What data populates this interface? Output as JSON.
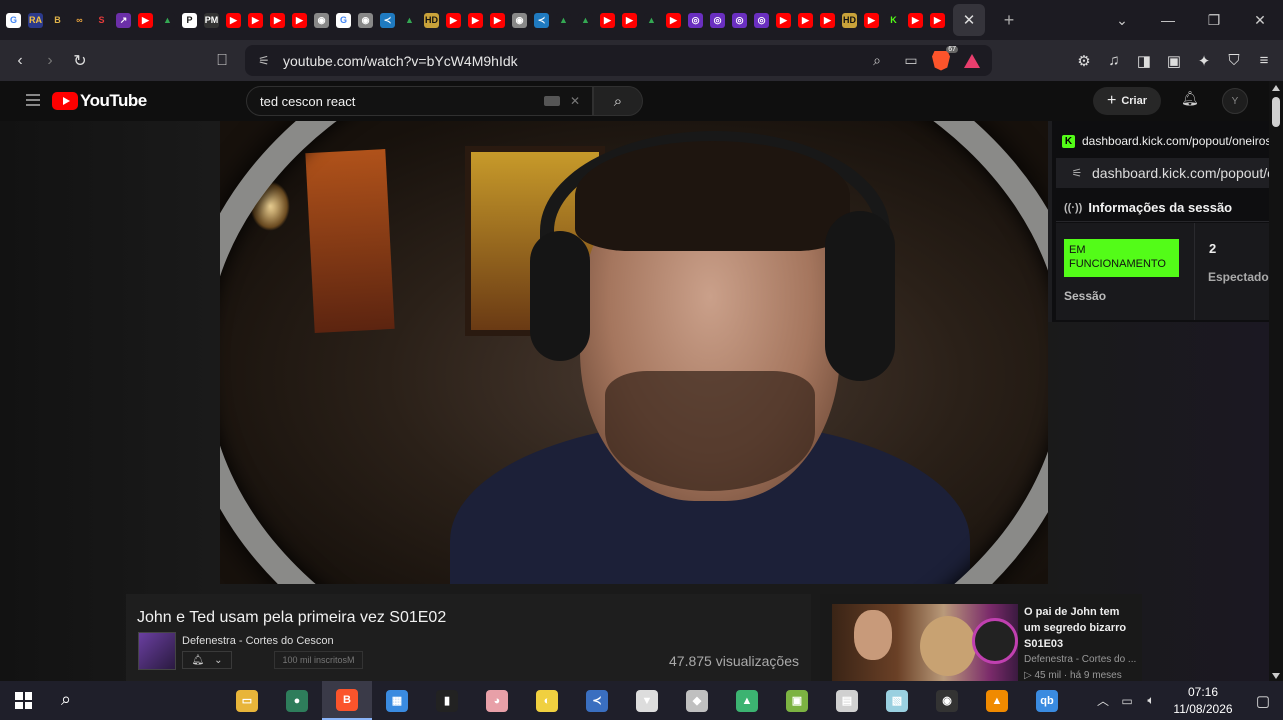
{
  "browser": {
    "tabs": [
      {
        "icon": "google-icon",
        "letter": "G",
        "color": "#ffffff",
        "fg": "#4285f4"
      },
      {
        "icon": "ra-icon",
        "letter": "RA",
        "color": "#2b3a8c",
        "fg": "#f6c343"
      },
      {
        "icon": "b-icon",
        "letter": "B",
        "color": "#1c1b22",
        "fg": "#e0b34a"
      },
      {
        "icon": "link-icon",
        "letter": "∞",
        "color": "#1c1b22",
        "fg": "#e7a33e"
      },
      {
        "icon": "s-icon",
        "letter": "S",
        "color": "#1c1b22",
        "fg": "#e43b3b"
      },
      {
        "icon": "external-icon",
        "letter": "↗",
        "color": "#6b2fa8",
        "fg": "#ffffff"
      },
      {
        "icon": "youtube-icon",
        "letter": "▶",
        "color": "#ff0000",
        "fg": "#ffffff"
      },
      {
        "icon": "drive-icon",
        "letter": "▲",
        "color": "#1c1b22",
        "fg": "#34a853"
      },
      {
        "icon": "p-icon",
        "letter": "P",
        "color": "#ffffff",
        "fg": "#111111"
      },
      {
        "icon": "pmm-icon",
        "letter": "PM",
        "color": "#333333",
        "fg": "#ffffff"
      },
      {
        "icon": "youtube-icon",
        "letter": "▶",
        "color": "#ff0000",
        "fg": "#ffffff"
      },
      {
        "icon": "youtube-icon",
        "letter": "▶",
        "color": "#ff0000",
        "fg": "#ffffff"
      },
      {
        "icon": "youtube-icon",
        "letter": "▶",
        "color": "#ff0000",
        "fg": "#ffffff"
      },
      {
        "icon": "youtube-icon",
        "letter": "▶",
        "color": "#ff0000",
        "fg": "#ffffff"
      },
      {
        "icon": "github-icon",
        "letter": "◉",
        "color": "#888888",
        "fg": "#ffffff"
      },
      {
        "icon": "google-icon",
        "letter": "G",
        "color": "#ffffff",
        "fg": "#4285f4"
      },
      {
        "icon": "github-icon",
        "letter": "◉",
        "color": "#888888",
        "fg": "#ffffff"
      },
      {
        "icon": "vscode-icon",
        "letter": "≺",
        "color": "#1f7ac0",
        "fg": "#ffffff"
      },
      {
        "icon": "drive-icon",
        "letter": "▲",
        "color": "#1c1b22",
        "fg": "#34a853"
      },
      {
        "icon": "hd-icon",
        "letter": "HD",
        "color": "#c9a23a",
        "fg": "#111111"
      },
      {
        "icon": "youtube-icon",
        "letter": "▶",
        "color": "#ff0000",
        "fg": "#ffffff"
      },
      {
        "icon": "youtube-icon",
        "letter": "▶",
        "color": "#ff0000",
        "fg": "#ffffff"
      },
      {
        "icon": "youtube-icon",
        "letter": "▶",
        "color": "#ff0000",
        "fg": "#ffffff"
      },
      {
        "icon": "github-icon",
        "letter": "◉",
        "color": "#888888",
        "fg": "#ffffff"
      },
      {
        "icon": "vscode-icon",
        "letter": "≺",
        "color": "#1f7ac0",
        "fg": "#ffffff"
      },
      {
        "icon": "drive-icon",
        "letter": "▲",
        "color": "#1c1b22",
        "fg": "#34a853"
      },
      {
        "icon": "drive-icon",
        "letter": "▲",
        "color": "#1c1b22",
        "fg": "#34a853"
      },
      {
        "icon": "youtube-icon",
        "letter": "▶",
        "color": "#ff0000",
        "fg": "#ffffff"
      },
      {
        "icon": "youtube-icon",
        "letter": "▶",
        "color": "#ff0000",
        "fg": "#ffffff"
      },
      {
        "icon": "drive-icon",
        "letter": "▲",
        "color": "#1c1b22",
        "fg": "#34a853"
      },
      {
        "icon": "youtube-icon",
        "letter": "▶",
        "color": "#ff0000",
        "fg": "#ffffff"
      },
      {
        "icon": "twitch-icon",
        "letter": "◎",
        "color": "#6a2fc0",
        "fg": "#ffffff"
      },
      {
        "icon": "twitch-icon",
        "letter": "◎",
        "color": "#6a2fc0",
        "fg": "#ffffff"
      },
      {
        "icon": "twitch-icon",
        "letter": "◎",
        "color": "#6a2fc0",
        "fg": "#ffffff"
      },
      {
        "icon": "twitch-icon",
        "letter": "◎",
        "color": "#6a2fc0",
        "fg": "#ffffff"
      },
      {
        "icon": "youtube-icon",
        "letter": "▶",
        "color": "#ff0000",
        "fg": "#ffffff"
      },
      {
        "icon": "youtube-icon",
        "letter": "▶",
        "color": "#ff0000",
        "fg": "#ffffff"
      },
      {
        "icon": "youtube-icon",
        "letter": "▶",
        "color": "#ff0000",
        "fg": "#ffffff"
      },
      {
        "icon": "hd-icon",
        "letter": "HD",
        "color": "#c9a23a",
        "fg": "#111111"
      },
      {
        "icon": "youtube-icon",
        "letter": "▶",
        "color": "#ff0000",
        "fg": "#ffffff"
      },
      {
        "icon": "kick-icon",
        "letter": "K",
        "color": "#1c1b22",
        "fg": "#53fc18"
      },
      {
        "icon": "youtube-icon",
        "letter": "▶",
        "color": "#ff0000",
        "fg": "#ffffff"
      },
      {
        "icon": "youtube-icon",
        "letter": "▶",
        "color": "#ff0000",
        "fg": "#ffffff"
      }
    ],
    "url": "youtube.com/watch?v=bYcW4M9hIdk",
    "brave_count": "67"
  },
  "youtube": {
    "logo_text": "YouTube",
    "search_query": "ted cescon react",
    "create_label": "Criar",
    "avatar_letter": "Y"
  },
  "kick": {
    "window_title": "dashboard.kick.com/popout/oneiros-fo",
    "address": "dashboard.kick.com/popout/on",
    "section_title": "Informações da sessão",
    "status_badge": "EM FUNCIONAMENTO",
    "session_label": "Sessão",
    "viewers_count": "2",
    "viewers_label": "Espectadores",
    "accent_color": "#53fc18"
  },
  "video": {
    "title": "John e Ted usam pela primeira vez S01E02",
    "channel": "Defenestra - Cortes do Cescon",
    "subscribers": "100 mil inscritosM",
    "views": "47.875 visualizações"
  },
  "recommended": {
    "title": "O pai de John tem um segredo bizarro S01E03",
    "channel": "Defenestra - Cortes do ...",
    "meta": "▷ 45 mil · há 9 meses"
  },
  "taskbar": {
    "apps": [
      {
        "icon": "file-explorer-icon",
        "color": "#e8b53a",
        "glyph": "▭"
      },
      {
        "icon": "orb-app-icon",
        "color": "#2e7d5b",
        "glyph": "●"
      },
      {
        "icon": "brave-icon",
        "color": "#fb542b",
        "glyph": "B"
      },
      {
        "icon": "store-icon",
        "color": "#3a8be0",
        "glyph": "▦"
      },
      {
        "icon": "audio-meter-icon",
        "color": "#222222",
        "glyph": "▮"
      },
      {
        "icon": "pig-icon",
        "color": "#e8a0a8",
        "glyph": "◕"
      },
      {
        "icon": "obs-like-icon",
        "color": "#f0d040",
        "glyph": "◐"
      },
      {
        "icon": "vscode-icon",
        "color": "#3a6fc0",
        "glyph": "≺"
      },
      {
        "icon": "fox-icon",
        "color": "#dddddd",
        "glyph": "▼"
      },
      {
        "icon": "gamepad-icon",
        "color": "#c0c0c0",
        "glyph": "◆"
      },
      {
        "icon": "tree-app-icon",
        "color": "#3cb371",
        "glyph": "▲"
      },
      {
        "icon": "archive-icon",
        "color": "#7cb342",
        "glyph": "▣"
      },
      {
        "icon": "document-icon",
        "color": "#d0d0d0",
        "glyph": "▤"
      },
      {
        "icon": "notes-icon",
        "color": "#9ad0e0",
        "glyph": "▧"
      },
      {
        "icon": "obs-icon",
        "color": "#333333",
        "glyph": "◉"
      },
      {
        "icon": "vlc-icon",
        "color": "#f08a00",
        "glyph": "▲"
      },
      {
        "icon": "qbittorrent-icon",
        "color": "#3a8be0",
        "glyph": "qb"
      }
    ],
    "time": "07:16",
    "date": "11/08/2026"
  }
}
